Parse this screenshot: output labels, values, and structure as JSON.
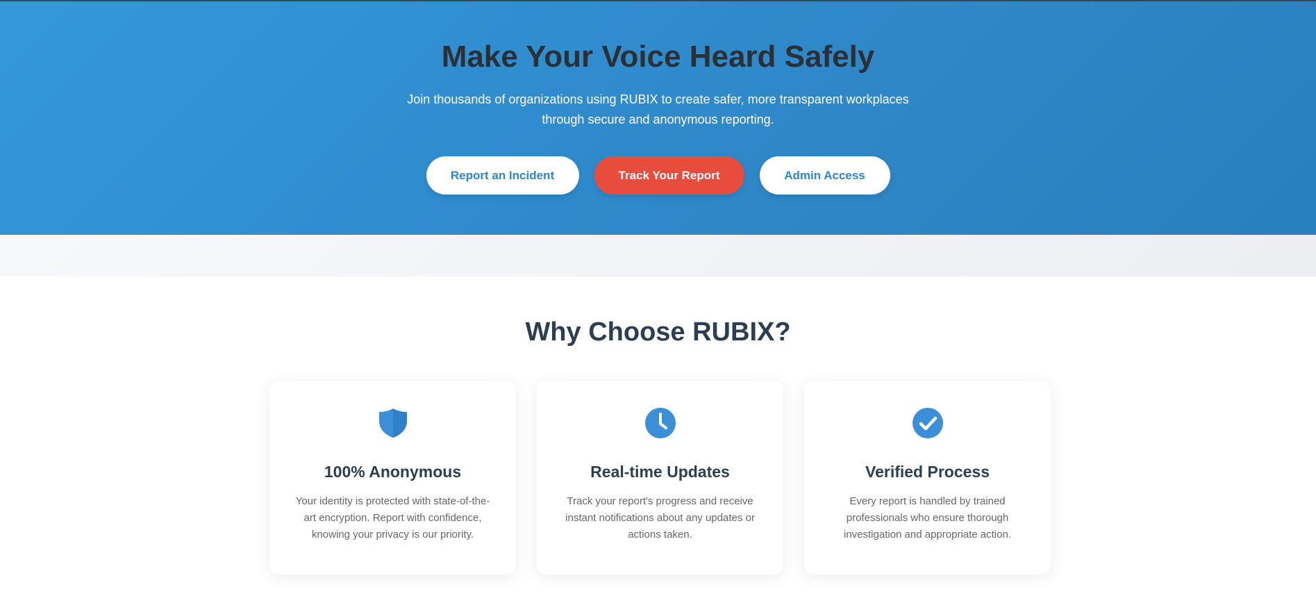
{
  "hero": {
    "title": "Make Your Voice Heard Safely",
    "subtitle": "Join thousands of organizations using RUBIX to create safer, more transparent workplaces through secure and anonymous reporting.",
    "buttons": {
      "report": "Report an Incident",
      "track": "Track Your Report",
      "admin": "Admin Access"
    }
  },
  "features": {
    "title": "Why Choose RUBIX?",
    "cards": [
      {
        "icon": "shield-icon",
        "title": "100% Anonymous",
        "text": "Your identity is protected with state-of-the-art encryption. Report with confidence, knowing your privacy is our priority."
      },
      {
        "icon": "clock-icon",
        "title": "Real-time Updates",
        "text": "Track your report's progress and receive instant notifications about any updates or actions taken."
      },
      {
        "icon": "check-circle-icon",
        "title": "Verified Process",
        "text": "Every report is handled by trained professionals who ensure thorough investigation and appropriate action."
      }
    ]
  },
  "colors": {
    "hero_blue": "#3498db",
    "accent_red": "#e74c3c",
    "heading_dark": "#2c3e50",
    "icon_blue": "#3a8fd8"
  }
}
